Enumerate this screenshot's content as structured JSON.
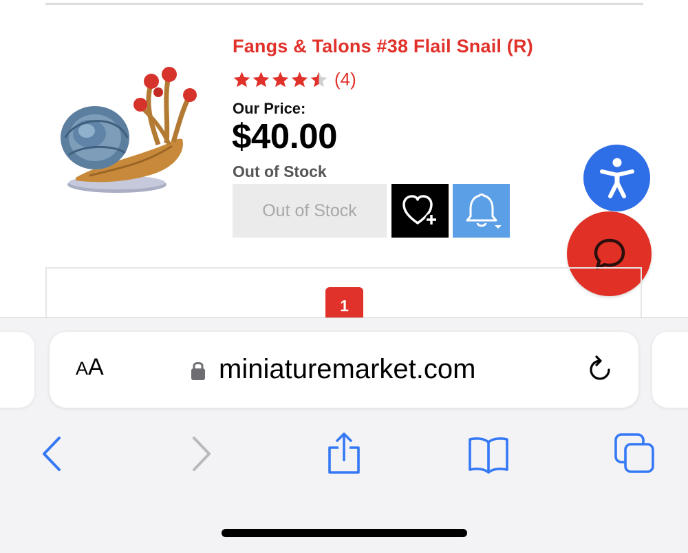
{
  "product": {
    "title": "Fangs & Talons #38 Flail Snail (R)",
    "rating": 4.5,
    "rating_count": "(4)",
    "price_label": "Our Price:",
    "price": "$40.00",
    "stock_status": "Out of Stock",
    "stock_button_label": "Out of Stock"
  },
  "pagination": {
    "current_page": "1"
  },
  "browser": {
    "text_size_label_small": "A",
    "text_size_label_large": "A",
    "url": "miniaturemarket.com"
  },
  "colors": {
    "brand_red": "#e0312a",
    "accessibility_blue": "#2e6ee6",
    "notify_blue": "#5b9fe6",
    "ios_blue": "#3478f6"
  },
  "icons": {
    "wishlist": "heart-plus-icon",
    "notify": "bell-icon",
    "accessibility": "accessibility-icon",
    "chat": "chat-bubble-icon",
    "lock": "lock-icon",
    "reload": "reload-icon",
    "back": "chevron-left-icon",
    "forward": "chevron-right-icon",
    "share": "share-icon",
    "bookmarks": "book-icon",
    "tabs": "tabs-icon"
  }
}
